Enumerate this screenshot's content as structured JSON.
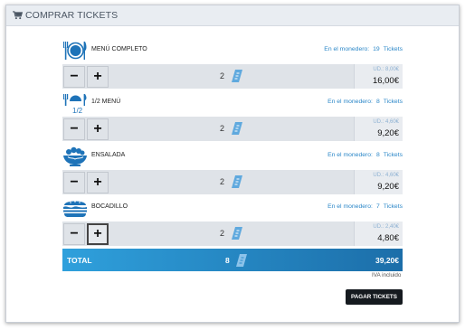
{
  "header": {
    "title": "COMPRAR TICKETS"
  },
  "wallet_prefix": "En el monedero:",
  "wallet_suffix": "Tickets",
  "unit_prefix": "UD.:",
  "items": [
    {
      "name": "MENÚ COMPLETO",
      "wallet_count": "19",
      "qty": "2",
      "unit_price": "8,00€",
      "total": "16,00€"
    },
    {
      "name": "1/2 MENÚ",
      "icon_text": "1/2",
      "wallet_count": "8",
      "qty": "2",
      "unit_price": "4,60€",
      "total": "9,20€"
    },
    {
      "name": "ENSALADA",
      "wallet_count": "8",
      "qty": "2",
      "unit_price": "4,60€",
      "total": "9,20€"
    },
    {
      "name": "BOCADILLO",
      "wallet_count": "7",
      "qty": "2",
      "unit_price": "2,40€",
      "total": "4,80€"
    }
  ],
  "summary": {
    "label": "TOTAL",
    "qty": "8",
    "price": "39,20€",
    "tax_note": "IVA incluido"
  },
  "pay_button": "PAGAR TICKETS",
  "colors": {
    "accent": "#2b87c8",
    "total_bar_start": "#2fa0dc",
    "total_bar_end": "#1c6ea9",
    "pay_button": "#151a1f"
  },
  "icons": {
    "header": "shopping-cart-icon",
    "menu": "plate-cutlery-icon",
    "half_menu": "half-plate-icon",
    "salad": "salad-bowl-icon",
    "sandwich": "sandwich-icon",
    "ticket": "ticket-icon"
  }
}
